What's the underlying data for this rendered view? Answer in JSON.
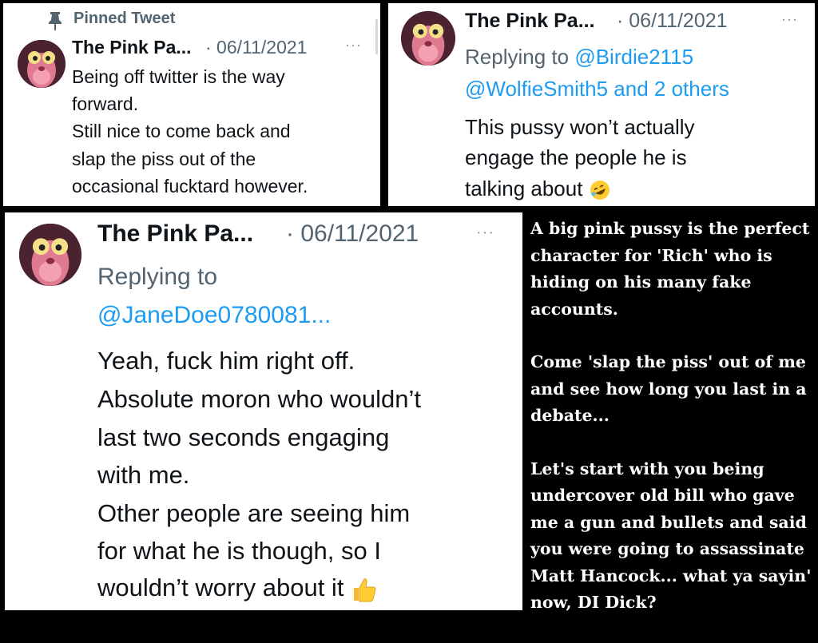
{
  "tweet1": {
    "pinned_label": "Pinned Tweet",
    "name": "The Pink Pa...",
    "date": "· 06/11/2021",
    "more": "···",
    "lines": [
      "Being off twitter is the way",
      "forward.",
      "Still nice to come back and",
      "slap the piss out of the",
      "occasional fucktard however."
    ]
  },
  "tweet2": {
    "name": "The Pink Pa...",
    "date": "· 06/11/2021",
    "more": "···",
    "replying_prefix": "Replying to ",
    "replying_handle1": "@Birdie2115",
    "replying_handles2": "@WolfieSmith5 and 2 others",
    "lines": [
      "This pussy won’t actually",
      "engage the people he is",
      "talking about"
    ],
    "emoji": "rolling-on-floor-laughing-emoji"
  },
  "tweet3": {
    "name": "The Pink Pa...",
    "date": "· 06/11/2021",
    "more": "···",
    "replying_prefix": "Replying to",
    "replying_handle": "@JaneDoe0780081...",
    "lines": [
      "Yeah, fuck him right off.",
      "Absolute moron who wouldn’t",
      "last two seconds engaging",
      "with me.",
      "Other people are seeing him",
      "for what he is though, so I",
      "wouldn’t worry about it"
    ],
    "emoji": "thumbs-up-emoji"
  },
  "caption": {
    "paragraphs": [
      "A big pink pussy is the perfect\ncharacter for 'Rich' who is\nhiding on his many fake\naccounts.",
      "Come 'slap the piss' out of me\nand see how long you last in a\ndebate...",
      "Let's start with you being\nundercover old bill who gave\nme a gun and bullets and said\nyou were going to assassinate\nMatt Hancock... what ya sayin'\nnow, DI Dick?"
    ]
  },
  "colors": {
    "background": "#000000",
    "panel": "#ffffff",
    "name": "#0f1419",
    "meta": "#536471",
    "link": "#1d9bf0",
    "caption_text": "#ffffff"
  }
}
